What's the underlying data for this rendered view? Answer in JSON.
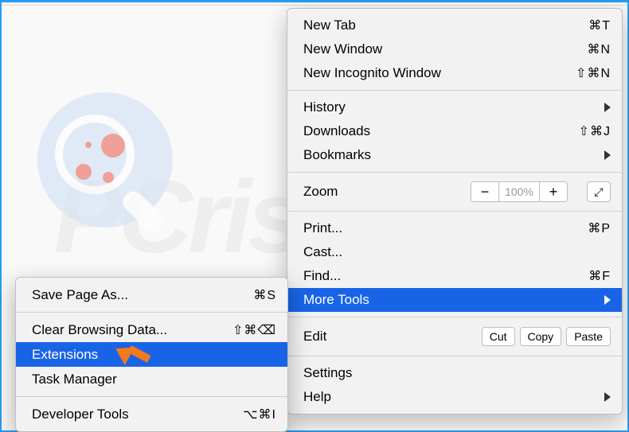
{
  "watermark": "PCrisk.com",
  "main_menu": {
    "new_tab": "New Tab",
    "new_tab_sc": "⌘T",
    "new_window": "New Window",
    "new_window_sc": "⌘N",
    "new_incognito": "New Incognito Window",
    "new_incognito_sc": "⇧⌘N",
    "history": "History",
    "downloads": "Downloads",
    "downloads_sc": "⇧⌘J",
    "bookmarks": "Bookmarks",
    "zoom": "Zoom",
    "zoom_value": "100%",
    "print": "Print...",
    "print_sc": "⌘P",
    "cast": "Cast...",
    "find": "Find...",
    "find_sc": "⌘F",
    "more_tools": "More Tools",
    "edit": "Edit",
    "edit_cut": "Cut",
    "edit_copy": "Copy",
    "edit_paste": "Paste",
    "settings": "Settings",
    "help": "Help"
  },
  "sub_menu": {
    "save_page": "Save Page As...",
    "save_page_sc": "⌘S",
    "clear_browsing": "Clear Browsing Data...",
    "clear_browsing_sc": "⇧⌘⌫",
    "extensions": "Extensions",
    "task_manager": "Task Manager",
    "developer_tools": "Developer Tools",
    "developer_tools_sc": "⌥⌘I"
  }
}
